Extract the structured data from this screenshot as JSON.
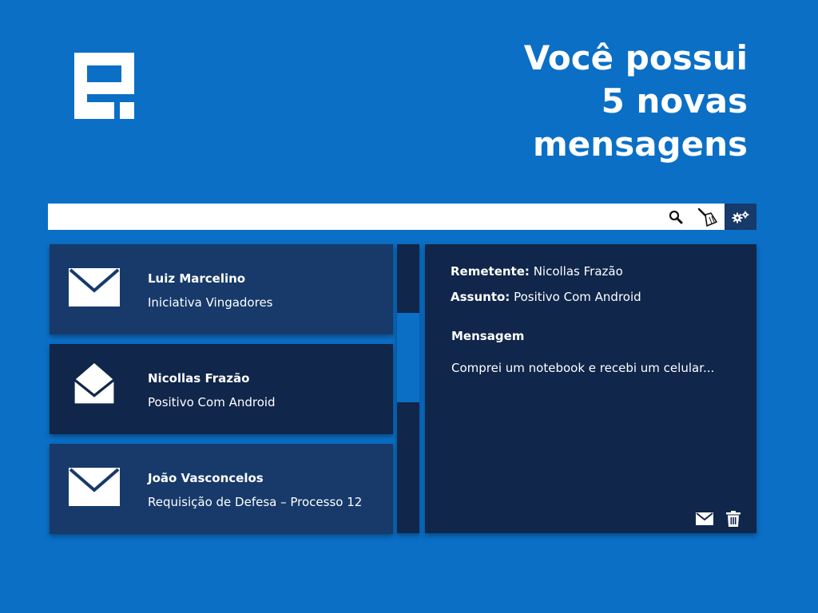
{
  "headline": [
    "Você possui",
    "5 novas",
    "mensagens"
  ],
  "search": {
    "value": "",
    "placeholder": ""
  },
  "messages": [
    {
      "name": "Luiz Marcelino",
      "subject": "Iniciativa Vingadores",
      "icon": "envelope-closed-icon",
      "state": "unread"
    },
    {
      "name": "Nicollas Frazão",
      "subject": "Positivo Com Android",
      "icon": "envelope-open-icon",
      "state": "selected"
    },
    {
      "name": "João Vasconcelos",
      "subject": "Requisição de Defesa – Processo 12",
      "icon": "envelope-closed-icon",
      "state": "unread"
    }
  ],
  "detail": {
    "sender_label": "Remetente:",
    "sender_value": "Nicollas Frazão",
    "subject_label": "Assunto:",
    "subject_value": "Positivo Com Android",
    "message_label": "Mensagem",
    "message_body": "Comprei um notebook e recebi um celular..."
  },
  "colors": {
    "background": "#0b6fc6",
    "card": "#173a6a",
    "card_active": "#10264a",
    "panel": "#10264a",
    "text": "#ffffff"
  },
  "icons": {
    "logo": "logo-icon",
    "search": "search-icon",
    "clean": "broom-icon",
    "settings": "gears-icon",
    "reply": "envelope-icon",
    "delete": "trash-icon"
  }
}
